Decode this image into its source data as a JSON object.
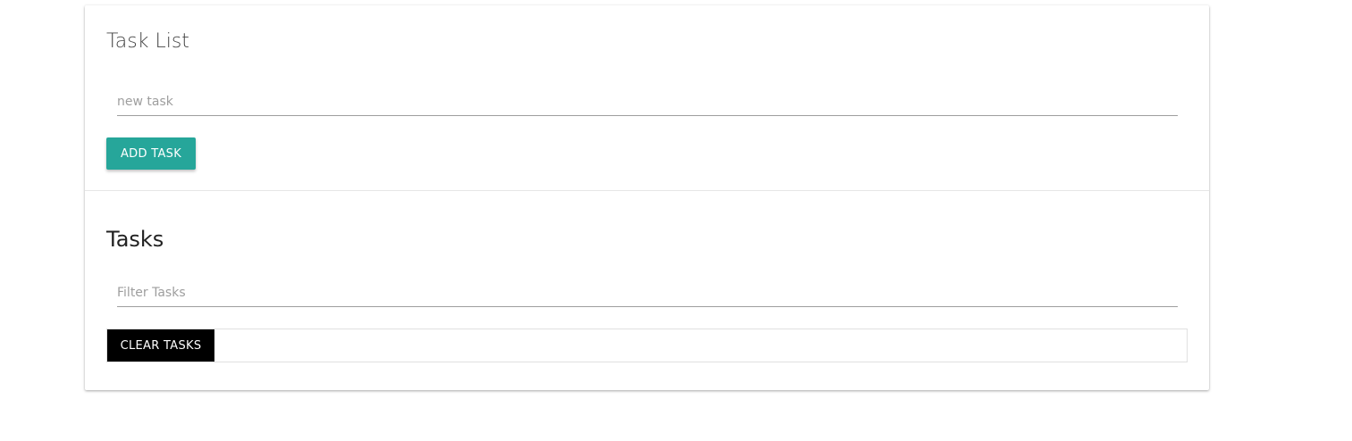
{
  "add_section": {
    "title": "Task List",
    "new_task_input": {
      "value": "",
      "placeholder": "new task"
    },
    "add_button_label": "ADD TASK"
  },
  "tasks_section": {
    "title": "Tasks",
    "filter_input": {
      "value": "",
      "placeholder": "Filter Tasks"
    },
    "clear_button_label": "CLEAR TASKS"
  },
  "colors": {
    "accent": "#26a69a",
    "clear_button": "#000000",
    "input_underline": "#9e9e9e"
  }
}
